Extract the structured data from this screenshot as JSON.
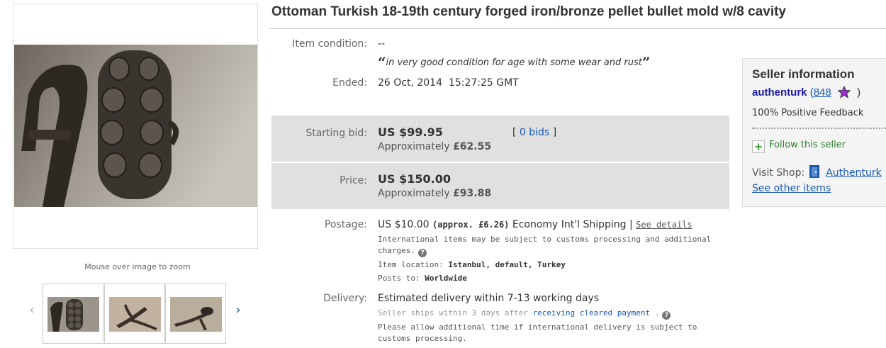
{
  "item": {
    "title": "Ottoman Turkish 18-19th century forged iron/bronze pellet bullet mold w/8 cavity"
  },
  "gallery": {
    "zoom_hint": "Mouse over image to zoom",
    "thumb_count": 3
  },
  "details": {
    "condition_label": "Item condition:",
    "condition_value": "--",
    "condition_quote_open": "“",
    "condition_quote": "in very good condition for age with some wear and rust",
    "condition_quote_close": "”",
    "ended_label": "Ended:",
    "ended_date": "26 Oct, 2014",
    "ended_time": "15:27:25 GMT"
  },
  "bidding": {
    "starting_label": "Starting bid:",
    "starting_value": "US $99.95",
    "starting_approx_prefix": "Approximately",
    "starting_approx_value": "£62.55",
    "bids_open": "[",
    "bids_link": "0 bids",
    "bids_close": "]",
    "price_label": "Price:",
    "price_value": "US $150.00",
    "price_approx_prefix": "Approximately",
    "price_approx_value": "£93.88"
  },
  "postage": {
    "label": "Postage:",
    "cost": "US $10.00",
    "approx": "(approx. £6.26)",
    "service": "Economy Int'l Shipping |",
    "see_details": "See details",
    "customs_note": "International items may be subject to customs processing and additional charges.",
    "location_label": "Item location:",
    "location_value": "Istanbul, default, Turkey",
    "posts_to_label": "Posts to:",
    "posts_to_value": "Worldwide"
  },
  "delivery": {
    "label": "Delivery:",
    "estimate": "Estimated delivery within 7-13 working days",
    "ships_prefix": "Seller ships within 3 days after",
    "ships_link": "receiving cleared payment",
    "ships_suffix": ".",
    "note": "Please allow additional time if international delivery is subject to customs processing."
  },
  "seller": {
    "heading": "Seller information",
    "name": "authenturk",
    "score_open": "(",
    "score": "848",
    "score_close": ")",
    "feedback": "100% Positive Feedback",
    "follow": "Follow this seller",
    "visit_shop_label": "Visit Shop:",
    "shop_name": "Authenturk",
    "see_other_items": "See other items",
    "star_color": "#9b2dc8"
  },
  "colors": {
    "link": "#1a5bb0",
    "price_panel": "#e0e0e0",
    "follow_green": "#2d7d2d"
  },
  "icons": {
    "prev": "chevron-left-icon",
    "next": "chevron-right-icon",
    "help": "help-icon",
    "star": "purple-star-icon",
    "follow": "plus-icon",
    "shop": "shop-door-icon"
  }
}
